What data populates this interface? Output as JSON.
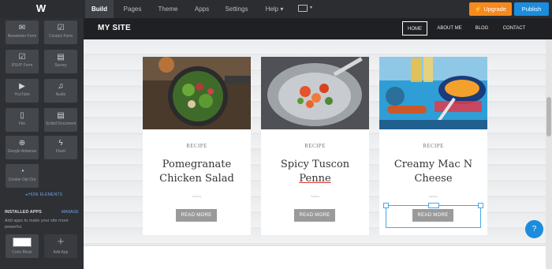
{
  "topbar": {
    "logo": "W",
    "tabs": [
      {
        "label": "Build",
        "active": true
      },
      {
        "label": "Pages",
        "active": false
      },
      {
        "label": "Theme",
        "active": false
      },
      {
        "label": "Apps",
        "active": false
      },
      {
        "label": "Settings",
        "active": false
      },
      {
        "label": "Help",
        "active": false
      }
    ],
    "help_caret": "▾",
    "device_caret": "▾",
    "upgrade_label": "⚡ Upgrade",
    "publish_label": "Publish",
    "colors": {
      "upgrade": "#f58a1f",
      "publish": "#1c8cdc"
    }
  },
  "sidebar": {
    "elements": [
      {
        "label": "Newsletter Form",
        "icon": "envelope-icon",
        "glyph": "✉"
      },
      {
        "label": "Contact Form",
        "icon": "form-icon",
        "glyph": "☑"
      },
      {
        "label": "RSVP Form",
        "icon": "rsvp-icon",
        "glyph": "☑"
      },
      {
        "label": "Survey",
        "icon": "survey-icon",
        "glyph": "▤"
      },
      {
        "label": "YouTube",
        "icon": "youtube-icon",
        "glyph": "▶"
      },
      {
        "label": "Audio",
        "icon": "audio-icon",
        "glyph": "♫"
      },
      {
        "label": "File",
        "icon": "file-icon",
        "glyph": "▯"
      },
      {
        "label": "Scribd Document",
        "icon": "document-icon",
        "glyph": "▤"
      },
      {
        "label": "Google Adsense",
        "icon": "adsense-icon",
        "glyph": "⊕"
      },
      {
        "label": "Flash",
        "icon": "flash-icon",
        "glyph": "ϟ"
      },
      {
        "label": "Cookie Opt Out",
        "icon": "cookie-icon",
        "glyph": "◔"
      }
    ],
    "hide_elements": "◂ HIDE ELEMENTS",
    "installed_apps": "INSTALLED APPS",
    "manage": "MANAGE",
    "add_apps_desc": "Add apps to make your site more powerful.",
    "color_block_label": "Color Block",
    "add_app_label": "Add App",
    "add_app_glyph": "+"
  },
  "site": {
    "title": "MY SITE",
    "nav": [
      {
        "label": "HOME",
        "active": true
      },
      {
        "label": "ABOUT ME",
        "active": false
      },
      {
        "label": "BLOG",
        "active": false
      },
      {
        "label": "CONTACT",
        "active": false
      }
    ],
    "cards": [
      {
        "kicker": "RECIPE",
        "title_line1": "Pomegranate",
        "title_line2": "Chicken Salad",
        "button": "READ MORE",
        "photo": "salad-photo"
      },
      {
        "kicker": "RECIPE",
        "title_line1": "Spicy Tuscon",
        "title_line2": "Penne",
        "button": "READ MORE",
        "photo": "penne-photo"
      },
      {
        "kicker": "RECIPE",
        "title_line1": "Creamy Mac N",
        "title_line2": "Cheese",
        "button": "READ MORE",
        "photo": "macaroni-photo"
      }
    ],
    "squiggle": "~~~",
    "help_glyph": "?"
  }
}
